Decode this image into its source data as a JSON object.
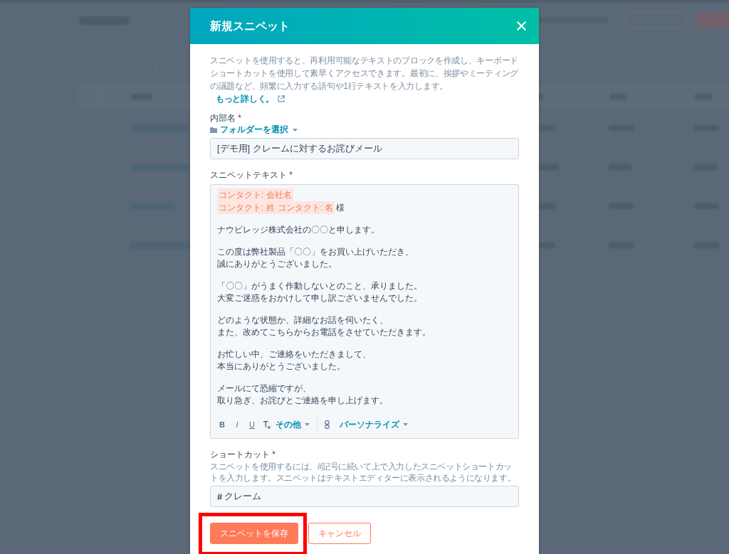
{
  "modal": {
    "title": "新規スニペット",
    "description": "スニペットを使用すると、再利用可能なテキストのブロックを作成し、キーボードショートカットを使用して素早くアクセスできます。最初に、挨拶やミーティングの議題など、頻繁に入力する語句や1行テキストを入力します。",
    "learn_more": "もっと詳しく。"
  },
  "internal_name": {
    "label": "内部名 *",
    "folder_select": "フォルダーを選択",
    "value": "[デモ用] クレームに対するお詫びメール"
  },
  "snippet_text": {
    "label": "スニペットテキスト *",
    "greeting_lines": [
      [
        {
          "kind": "token",
          "text": "コンタクト: 会社名"
        }
      ],
      [
        {
          "kind": "token",
          "text": "コンタクト: 姓"
        },
        {
          "kind": "token",
          "text": "コンタクト: 名"
        },
        {
          "kind": "text",
          "text": "様"
        }
      ]
    ],
    "paragraphs": [
      [
        "ナウビレッジ株式会社の〇〇と申します。"
      ],
      [
        "この度は弊社製品「〇〇」をお買い上げいただき、",
        "誠にありがとうございました。"
      ],
      [
        "「〇〇」がうまく作動しないとのこと、承りました。",
        "大変ご迷惑をおかけして申し訳ございませんでした。"
      ],
      [
        "どのような状態か、詳細なお話を伺いたく、",
        "また、改めてこちらからお電話をさせていただきます。"
      ],
      [
        "お忙しい中、ご連絡をいただきまして、",
        "本当にありがとうございました。"
      ],
      [
        "メールにて恐縮ですが、",
        "取り急ぎ、お詫びとご連絡を申し上げます。"
      ]
    ],
    "toolbar": [
      {
        "kind": "bold",
        "label": "B"
      },
      {
        "kind": "italic",
        "label": "I"
      },
      {
        "kind": "underline",
        "label": "U"
      },
      {
        "kind": "clear"
      },
      {
        "kind": "menu",
        "label": "その他"
      },
      {
        "kind": "divider"
      },
      {
        "kind": "link"
      },
      {
        "kind": "menu",
        "label": "パーソナライズ"
      }
    ]
  },
  "shortcut": {
    "label": "ショートカット *",
    "help": "スニペットを使用するには、#記号に続いて上で入力したスニペットショートカットを入力します。スニペットはテキストエディターに表示されるようになります。",
    "prefix": "#",
    "value": "クレーム"
  },
  "buttons": [
    {
      "kind": "primary",
      "label": "スニペットを保存",
      "highlighted": true
    },
    {
      "kind": "secondary",
      "label": "キャンセル",
      "highlighted": false
    }
  ]
}
